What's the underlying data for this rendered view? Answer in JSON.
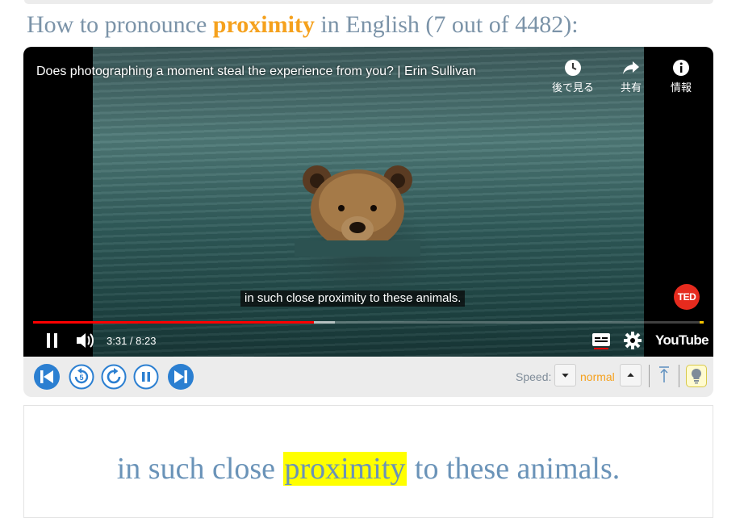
{
  "heading": {
    "prefix": "How to pronounce ",
    "keyword": "proximity",
    "suffix": " in English (7 out of 4482):"
  },
  "video": {
    "title": "Does photographing a moment steal the experience from you? | Erin Sullivan",
    "watch_later_label": "後で見る",
    "share_label": "共有",
    "info_label": "情報",
    "caption": "in such close proximity to these animals.",
    "brand_badge": "TED",
    "time": "3:31 / 8:23",
    "progress_fraction": 0.419,
    "buffered_fraction": 0.45,
    "youtube_label": "YouTube",
    "icons": [
      "pause-icon",
      "volume-icon",
      "subtitles-icon",
      "settings-gear-icon"
    ]
  },
  "toolbar": {
    "icons": [
      "previous-icon",
      "rewind-5-icon",
      "replay-icon",
      "pause-icon",
      "next-icon",
      "speed-down-icon",
      "speed-up-icon",
      "scroll-top-icon",
      "lightbulb-icon"
    ],
    "speed_label": "Speed:",
    "speed_value": "normal"
  },
  "sentence": {
    "before": "in such close ",
    "keyword": "proximity",
    "after": " to these animals."
  },
  "colors": {
    "accent_orange": "#f5a11d",
    "heading_gray": "#7b93a8",
    "toolbar_blue": "#2b7fd1",
    "highlight": "#ffff00",
    "progress_red": "#ff0000"
  }
}
